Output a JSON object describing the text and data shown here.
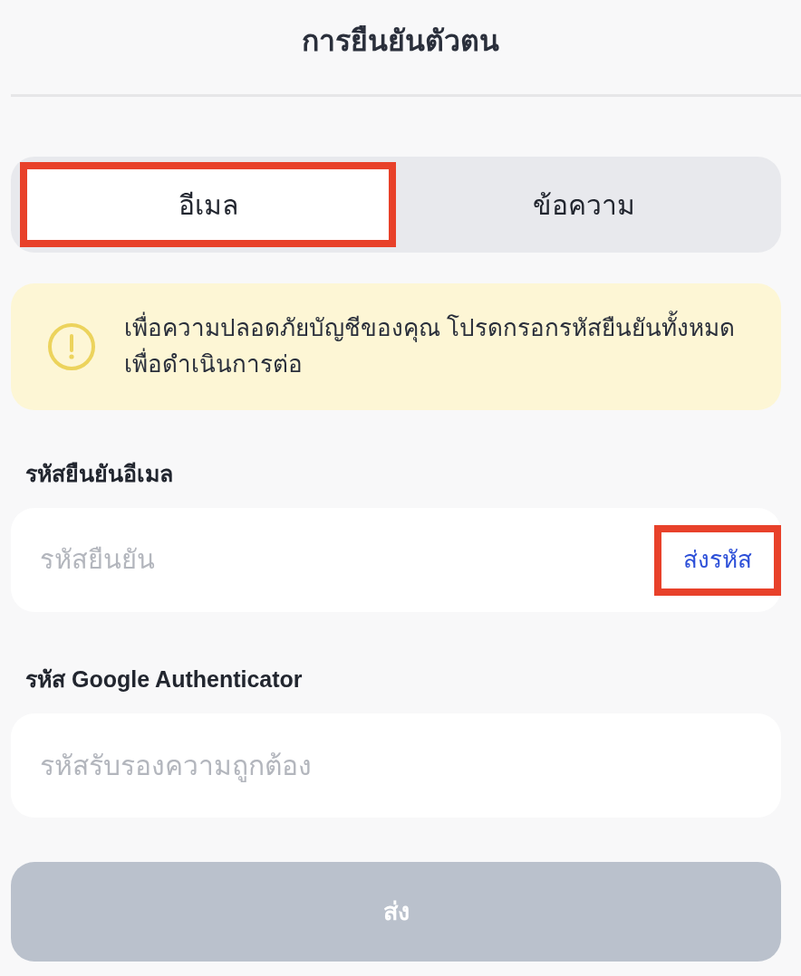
{
  "header": {
    "title": "การยืนยันตัวตน"
  },
  "tabs": [
    {
      "label": "อีเมล",
      "selected": true,
      "highlighted": true
    },
    {
      "label": "ข้อความ",
      "selected": false,
      "highlighted": false
    }
  ],
  "notice": {
    "text": "เพื่อความปลอดภัยบัญชีของคุณ โปรดกรอกรหัสยืนยันทั้งหมดเพื่อดำเนินการต่อ"
  },
  "fields": [
    {
      "label": "รหัสยืนยันอีเมล",
      "placeholder": "รหัสยืนยัน",
      "action": {
        "label": "ส่งรหัส",
        "highlighted": true
      }
    },
    {
      "label": "รหัส Google Authenticator",
      "placeholder": "รหัสรับรองความถูกต้อง"
    }
  ],
  "submit_button": {
    "label": "ส่ง",
    "disabled": true
  }
}
